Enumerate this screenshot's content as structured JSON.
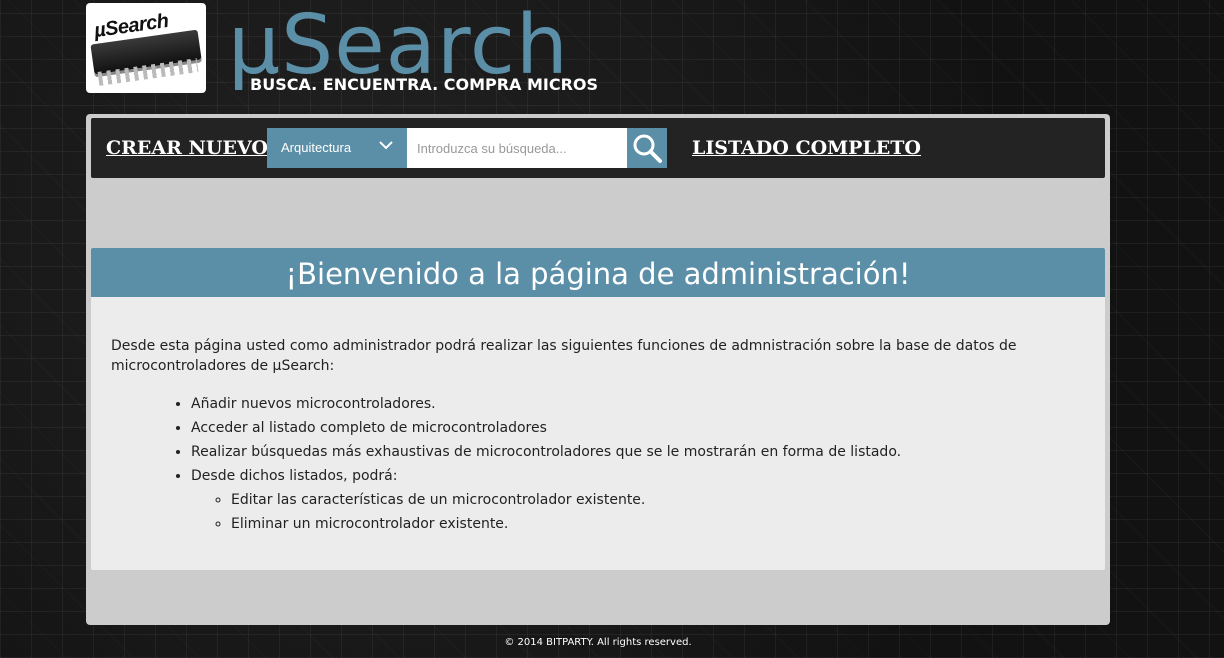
{
  "header": {
    "logo_text": "µSearch",
    "brand_title": "µSearch",
    "slogan": "BUSCA. ENCUENTRA. COMPRA MICROS"
  },
  "nav": {
    "create_label": "CREAR NUEVO",
    "list_label": "LISTADO COMPLETO",
    "search": {
      "category_selected": "Arquitectura",
      "placeholder": "Introduzca su búsqueda...",
      "value": ""
    }
  },
  "welcome": {
    "title": "¡Bienvenido a la página de administración!",
    "intro": "Desde esta página usted como administrador podrá realizar las siguientes funciones de admnistración sobre la base de datos de microcontroladores de µSearch:",
    "items": [
      "Añadir nuevos microcontroladores.",
      "Acceder al listado completo de microcontroladores",
      "Realizar búsquedas más exhaustivas de microcontroladores que se le mostrarán en forma de listado.",
      "Desde dichos listados, podrá:"
    ],
    "subitems": [
      "Editar las características de un microcontrolador existente.",
      "Eliminar un microcontrolador existente."
    ]
  },
  "footer": {
    "text": "© 2014 BITPARTY. All rights reserved."
  },
  "colors": {
    "accent": "#5b8fa8",
    "navbar": "#232323",
    "panel": "#cccccc",
    "card": "#ececec"
  },
  "icons": {
    "search": "magnifier-icon",
    "dropdown": "chevron-down-icon",
    "logo": "microchip-icon"
  }
}
